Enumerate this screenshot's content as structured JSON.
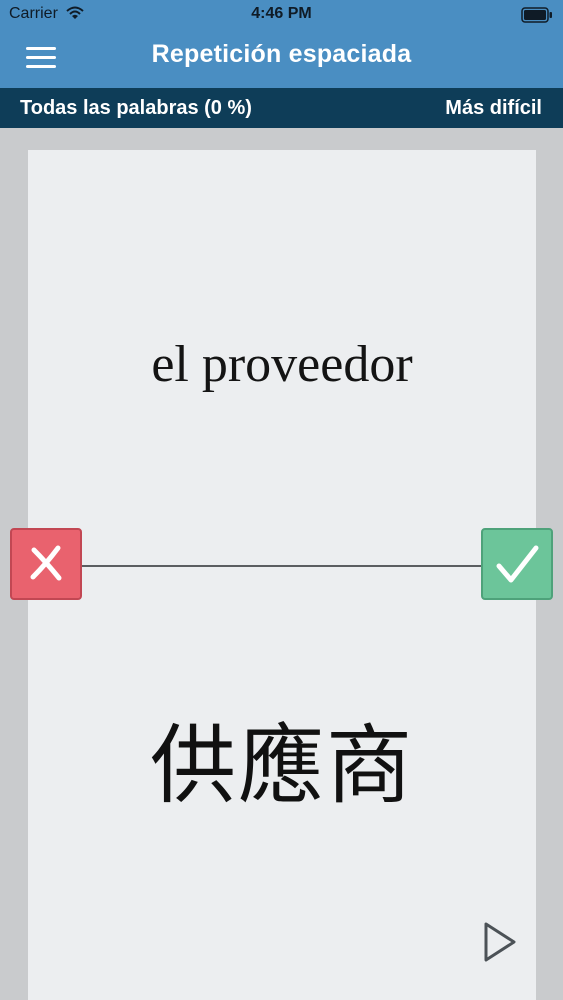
{
  "status_bar": {
    "carrier": "Carrier",
    "time": "4:46 PM",
    "wifi_icon": "wifi-icon",
    "battery_icon": "battery-icon"
  },
  "nav": {
    "title": "Repetición espaciada",
    "menu_icon": "hamburger-menu-icon"
  },
  "filter_bar": {
    "left_label": "Todas las palabras (0 %)",
    "right_label": "Más difícil"
  },
  "card": {
    "front_word": "el proveedor",
    "back_word": "供應商",
    "wrong_icon": "cross-icon",
    "correct_icon": "checkmark-icon",
    "play_icon": "play-icon"
  },
  "colors": {
    "header": "#4a8ec2",
    "filter_bar": "#0e3d58",
    "wrong": "#e9626e",
    "correct": "#6cc59a",
    "card": "#eceef0",
    "background": "#c9cbcd"
  }
}
